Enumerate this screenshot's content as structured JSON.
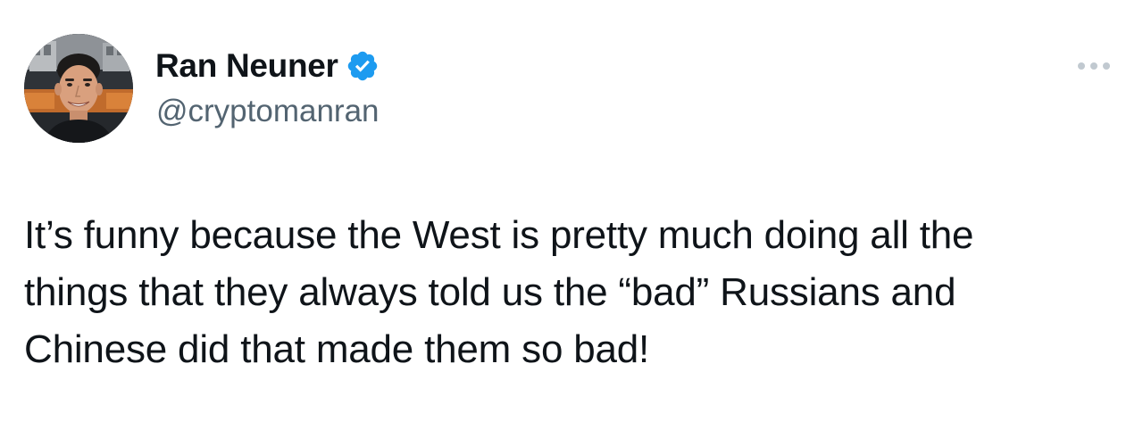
{
  "author": {
    "display_name": "Ran Neuner",
    "handle": "@cryptomanran",
    "verified": true,
    "avatar_icon": "profile-photo"
  },
  "menu": {
    "icon": "more-horizontal-icon"
  },
  "tweet": {
    "lines": [
      "It’s funny because the West is pretty much doing all the",
      "things that they always told us the “bad” Russians and",
      "Chinese did that made them so bad!"
    ]
  },
  "colors": {
    "text": "#0f1419",
    "secondary_text": "#536471",
    "verified_badge": "#1d9bf0",
    "menu_dots": "#c1c9d0",
    "background": "#ffffff"
  }
}
